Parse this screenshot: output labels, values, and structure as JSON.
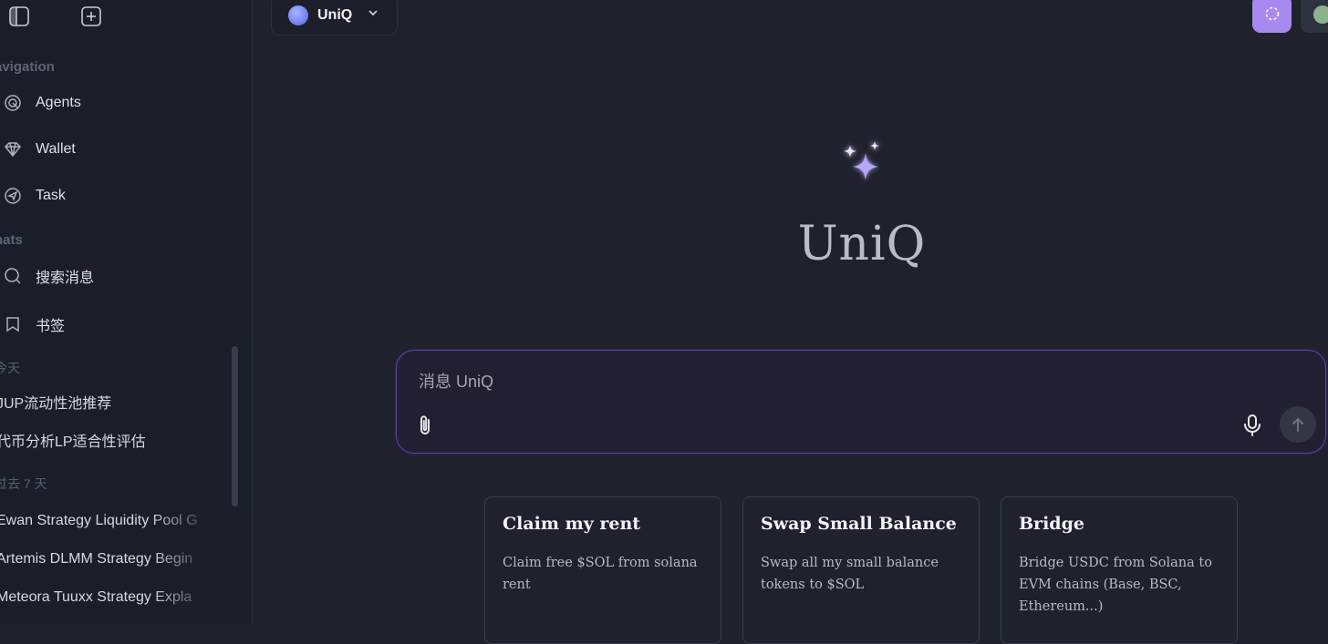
{
  "sidebar": {
    "sections": {
      "navigation": "avigation",
      "chats": "hats",
      "today": "今天",
      "past7": "过去 7 天"
    },
    "nav_items": [
      {
        "label": "Agents",
        "icon": "agent-target-icon"
      },
      {
        "label": "Wallet",
        "icon": "diamond-icon"
      },
      {
        "label": "Task",
        "icon": "send-icon"
      }
    ],
    "chat_tools": [
      {
        "label": "搜索消息",
        "icon": "search-icon"
      },
      {
        "label": "书签",
        "icon": "bookmark-icon"
      }
    ],
    "today_chats": [
      "JUP流动性池推荐",
      "代币分析LP适合性评估"
    ],
    "past7_chats": [
      "Ewan Strategy Liquidity Pool G",
      "Artemis DLMM Strategy Begin",
      "Meteora Tuuxx Strategy Expla"
    ]
  },
  "header": {
    "model_name": "UniQ"
  },
  "hero": {
    "title": "UniQ"
  },
  "composer": {
    "placeholder": "消息 UniQ"
  },
  "cards": [
    {
      "title": "Claim my rent",
      "desc": "Claim free $SOL from solana rent"
    },
    {
      "title": "Swap Small Balance",
      "desc": "Swap all my small balance tokens to $SOL"
    },
    {
      "title": "Bridge",
      "desc": "Bridge USDC from Solana to EVM chains (Base, BSC, Ethereum...)"
    }
  ],
  "colors": {
    "accent": "#a889f0",
    "background": "#1f222d",
    "sidebar": "#1b1e28",
    "composer_border": "#5b3fb0"
  }
}
